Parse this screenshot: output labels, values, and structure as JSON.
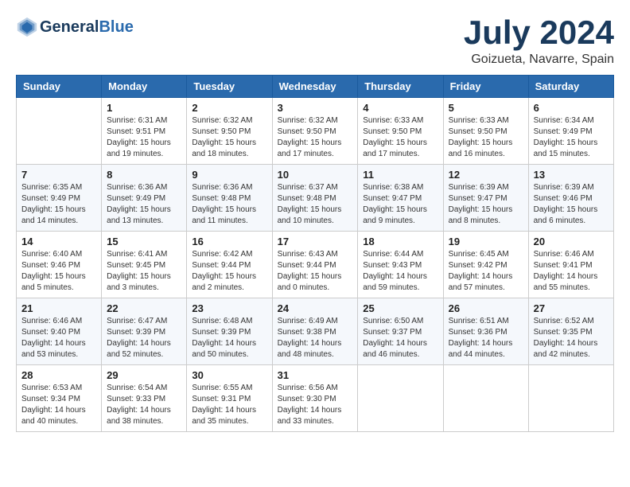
{
  "header": {
    "logo_general": "General",
    "logo_blue": "Blue",
    "month_title": "July 2024",
    "subtitle": "Goizueta, Navarre, Spain"
  },
  "weekdays": [
    "Sunday",
    "Monday",
    "Tuesday",
    "Wednesday",
    "Thursday",
    "Friday",
    "Saturday"
  ],
  "weeks": [
    [
      {
        "day": "",
        "info": ""
      },
      {
        "day": "1",
        "info": "Sunrise: 6:31 AM\nSunset: 9:51 PM\nDaylight: 15 hours\nand 19 minutes."
      },
      {
        "day": "2",
        "info": "Sunrise: 6:32 AM\nSunset: 9:50 PM\nDaylight: 15 hours\nand 18 minutes."
      },
      {
        "day": "3",
        "info": "Sunrise: 6:32 AM\nSunset: 9:50 PM\nDaylight: 15 hours\nand 17 minutes."
      },
      {
        "day": "4",
        "info": "Sunrise: 6:33 AM\nSunset: 9:50 PM\nDaylight: 15 hours\nand 17 minutes."
      },
      {
        "day": "5",
        "info": "Sunrise: 6:33 AM\nSunset: 9:50 PM\nDaylight: 15 hours\nand 16 minutes."
      },
      {
        "day": "6",
        "info": "Sunrise: 6:34 AM\nSunset: 9:49 PM\nDaylight: 15 hours\nand 15 minutes."
      }
    ],
    [
      {
        "day": "7",
        "info": "Sunrise: 6:35 AM\nSunset: 9:49 PM\nDaylight: 15 hours\nand 14 minutes."
      },
      {
        "day": "8",
        "info": "Sunrise: 6:36 AM\nSunset: 9:49 PM\nDaylight: 15 hours\nand 13 minutes."
      },
      {
        "day": "9",
        "info": "Sunrise: 6:36 AM\nSunset: 9:48 PM\nDaylight: 15 hours\nand 11 minutes."
      },
      {
        "day": "10",
        "info": "Sunrise: 6:37 AM\nSunset: 9:48 PM\nDaylight: 15 hours\nand 10 minutes."
      },
      {
        "day": "11",
        "info": "Sunrise: 6:38 AM\nSunset: 9:47 PM\nDaylight: 15 hours\nand 9 minutes."
      },
      {
        "day": "12",
        "info": "Sunrise: 6:39 AM\nSunset: 9:47 PM\nDaylight: 15 hours\nand 8 minutes."
      },
      {
        "day": "13",
        "info": "Sunrise: 6:39 AM\nSunset: 9:46 PM\nDaylight: 15 hours\nand 6 minutes."
      }
    ],
    [
      {
        "day": "14",
        "info": "Sunrise: 6:40 AM\nSunset: 9:46 PM\nDaylight: 15 hours\nand 5 minutes."
      },
      {
        "day": "15",
        "info": "Sunrise: 6:41 AM\nSunset: 9:45 PM\nDaylight: 15 hours\nand 3 minutes."
      },
      {
        "day": "16",
        "info": "Sunrise: 6:42 AM\nSunset: 9:44 PM\nDaylight: 15 hours\nand 2 minutes."
      },
      {
        "day": "17",
        "info": "Sunrise: 6:43 AM\nSunset: 9:44 PM\nDaylight: 15 hours\nand 0 minutes."
      },
      {
        "day": "18",
        "info": "Sunrise: 6:44 AM\nSunset: 9:43 PM\nDaylight: 14 hours\nand 59 minutes."
      },
      {
        "day": "19",
        "info": "Sunrise: 6:45 AM\nSunset: 9:42 PM\nDaylight: 14 hours\nand 57 minutes."
      },
      {
        "day": "20",
        "info": "Sunrise: 6:46 AM\nSunset: 9:41 PM\nDaylight: 14 hours\nand 55 minutes."
      }
    ],
    [
      {
        "day": "21",
        "info": "Sunrise: 6:46 AM\nSunset: 9:40 PM\nDaylight: 14 hours\nand 53 minutes."
      },
      {
        "day": "22",
        "info": "Sunrise: 6:47 AM\nSunset: 9:39 PM\nDaylight: 14 hours\nand 52 minutes."
      },
      {
        "day": "23",
        "info": "Sunrise: 6:48 AM\nSunset: 9:39 PM\nDaylight: 14 hours\nand 50 minutes."
      },
      {
        "day": "24",
        "info": "Sunrise: 6:49 AM\nSunset: 9:38 PM\nDaylight: 14 hours\nand 48 minutes."
      },
      {
        "day": "25",
        "info": "Sunrise: 6:50 AM\nSunset: 9:37 PM\nDaylight: 14 hours\nand 46 minutes."
      },
      {
        "day": "26",
        "info": "Sunrise: 6:51 AM\nSunset: 9:36 PM\nDaylight: 14 hours\nand 44 minutes."
      },
      {
        "day": "27",
        "info": "Sunrise: 6:52 AM\nSunset: 9:35 PM\nDaylight: 14 hours\nand 42 minutes."
      }
    ],
    [
      {
        "day": "28",
        "info": "Sunrise: 6:53 AM\nSunset: 9:34 PM\nDaylight: 14 hours\nand 40 minutes."
      },
      {
        "day": "29",
        "info": "Sunrise: 6:54 AM\nSunset: 9:33 PM\nDaylight: 14 hours\nand 38 minutes."
      },
      {
        "day": "30",
        "info": "Sunrise: 6:55 AM\nSunset: 9:31 PM\nDaylight: 14 hours\nand 35 minutes."
      },
      {
        "day": "31",
        "info": "Sunrise: 6:56 AM\nSunset: 9:30 PM\nDaylight: 14 hours\nand 33 minutes."
      },
      {
        "day": "",
        "info": ""
      },
      {
        "day": "",
        "info": ""
      },
      {
        "day": "",
        "info": ""
      }
    ]
  ]
}
